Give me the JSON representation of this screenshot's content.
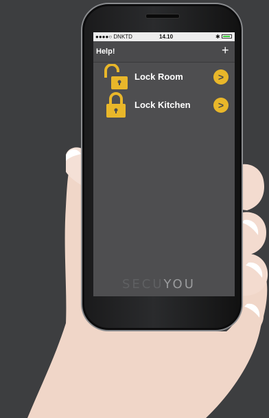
{
  "status_bar": {
    "carrier": "●●●●○ DNKTD",
    "time": "14.10",
    "battery_level": 0.9
  },
  "nav": {
    "title": "Help!",
    "add_icon": "plus-icon"
  },
  "locks": [
    {
      "label": "Lock Room",
      "state": "unlocked",
      "icon": "open-padlock-icon"
    },
    {
      "label": "Lock Kitchen",
      "state": "locked",
      "icon": "closed-padlock-icon"
    }
  ],
  "brand": {
    "part1": "SECU",
    "part2": "YOU"
  },
  "colors": {
    "accent": "#e9b72a",
    "screen_bg": "#4e4e50",
    "background": "#3d3e40"
  }
}
